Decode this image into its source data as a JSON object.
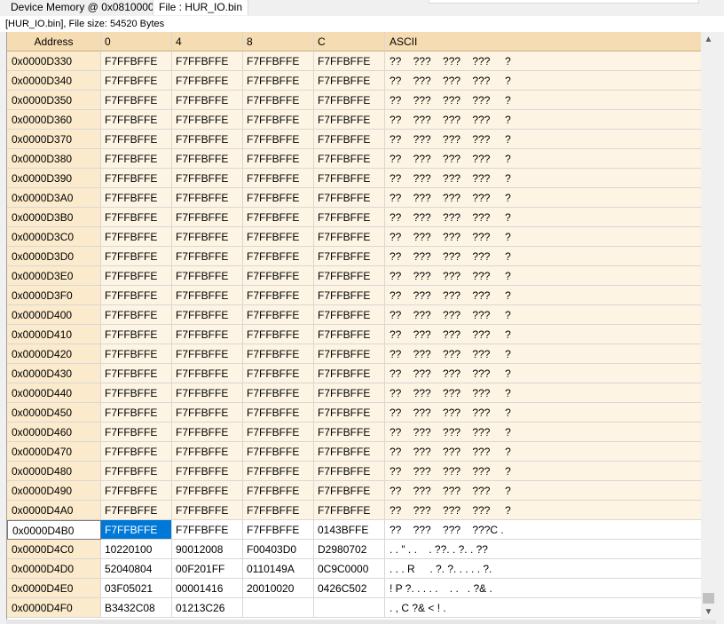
{
  "tabs": {
    "device_memory": "Device Memory @ 0x08100000 :",
    "file": "File : HUR_IO.bin"
  },
  "info": "[HUR_IO.bin], File size: 54520 Bytes",
  "columns": {
    "address": "Address",
    "c0": "0",
    "c4": "4",
    "c8": "8",
    "cc": "C",
    "ascii": "ASCII"
  },
  "rows": [
    {
      "addr": "0x0000D330",
      "c0": "F7FFBFFE",
      "c4": "F7FFBFFE",
      "c8": "F7FFBFFE",
      "cc": "F7FFBFFE",
      "ascii": "??    ???    ???    ???     ?"
    },
    {
      "addr": "0x0000D340",
      "c0": "F7FFBFFE",
      "c4": "F7FFBFFE",
      "c8": "F7FFBFFE",
      "cc": "F7FFBFFE",
      "ascii": "??    ???    ???    ???     ?"
    },
    {
      "addr": "0x0000D350",
      "c0": "F7FFBFFE",
      "c4": "F7FFBFFE",
      "c8": "F7FFBFFE",
      "cc": "F7FFBFFE",
      "ascii": "??    ???    ???    ???     ?"
    },
    {
      "addr": "0x0000D360",
      "c0": "F7FFBFFE",
      "c4": "F7FFBFFE",
      "c8": "F7FFBFFE",
      "cc": "F7FFBFFE",
      "ascii": "??    ???    ???    ???     ?"
    },
    {
      "addr": "0x0000D370",
      "c0": "F7FFBFFE",
      "c4": "F7FFBFFE",
      "c8": "F7FFBFFE",
      "cc": "F7FFBFFE",
      "ascii": "??    ???    ???    ???     ?"
    },
    {
      "addr": "0x0000D380",
      "c0": "F7FFBFFE",
      "c4": "F7FFBFFE",
      "c8": "F7FFBFFE",
      "cc": "F7FFBFFE",
      "ascii": "??    ???    ???    ???     ?"
    },
    {
      "addr": "0x0000D390",
      "c0": "F7FFBFFE",
      "c4": "F7FFBFFE",
      "c8": "F7FFBFFE",
      "cc": "F7FFBFFE",
      "ascii": "??    ???    ???    ???     ?"
    },
    {
      "addr": "0x0000D3A0",
      "c0": "F7FFBFFE",
      "c4": "F7FFBFFE",
      "c8": "F7FFBFFE",
      "cc": "F7FFBFFE",
      "ascii": "??    ???    ???    ???     ?"
    },
    {
      "addr": "0x0000D3B0",
      "c0": "F7FFBFFE",
      "c4": "F7FFBFFE",
      "c8": "F7FFBFFE",
      "cc": "F7FFBFFE",
      "ascii": "??    ???    ???    ???     ?"
    },
    {
      "addr": "0x0000D3C0",
      "c0": "F7FFBFFE",
      "c4": "F7FFBFFE",
      "c8": "F7FFBFFE",
      "cc": "F7FFBFFE",
      "ascii": "??    ???    ???    ???     ?"
    },
    {
      "addr": "0x0000D3D0",
      "c0": "F7FFBFFE",
      "c4": "F7FFBFFE",
      "c8": "F7FFBFFE",
      "cc": "F7FFBFFE",
      "ascii": "??    ???    ???    ???     ?"
    },
    {
      "addr": "0x0000D3E0",
      "c0": "F7FFBFFE",
      "c4": "F7FFBFFE",
      "c8": "F7FFBFFE",
      "cc": "F7FFBFFE",
      "ascii": "??    ???    ???    ???     ?"
    },
    {
      "addr": "0x0000D3F0",
      "c0": "F7FFBFFE",
      "c4": "F7FFBFFE",
      "c8": "F7FFBFFE",
      "cc": "F7FFBFFE",
      "ascii": "??    ???    ???    ???     ?"
    },
    {
      "addr": "0x0000D400",
      "c0": "F7FFBFFE",
      "c4": "F7FFBFFE",
      "c8": "F7FFBFFE",
      "cc": "F7FFBFFE",
      "ascii": "??    ???    ???    ???     ?"
    },
    {
      "addr": "0x0000D410",
      "c0": "F7FFBFFE",
      "c4": "F7FFBFFE",
      "c8": "F7FFBFFE",
      "cc": "F7FFBFFE",
      "ascii": "??    ???    ???    ???     ?"
    },
    {
      "addr": "0x0000D420",
      "c0": "F7FFBFFE",
      "c4": "F7FFBFFE",
      "c8": "F7FFBFFE",
      "cc": "F7FFBFFE",
      "ascii": "??    ???    ???    ???     ?"
    },
    {
      "addr": "0x0000D430",
      "c0": "F7FFBFFE",
      "c4": "F7FFBFFE",
      "c8": "F7FFBFFE",
      "cc": "F7FFBFFE",
      "ascii": "??    ???    ???    ???     ?"
    },
    {
      "addr": "0x0000D440",
      "c0": "F7FFBFFE",
      "c4": "F7FFBFFE",
      "c8": "F7FFBFFE",
      "cc": "F7FFBFFE",
      "ascii": "??    ???    ???    ???     ?"
    },
    {
      "addr": "0x0000D450",
      "c0": "F7FFBFFE",
      "c4": "F7FFBFFE",
      "c8": "F7FFBFFE",
      "cc": "F7FFBFFE",
      "ascii": "??    ???    ???    ???     ?"
    },
    {
      "addr": "0x0000D460",
      "c0": "F7FFBFFE",
      "c4": "F7FFBFFE",
      "c8": "F7FFBFFE",
      "cc": "F7FFBFFE",
      "ascii": "??    ???    ???    ???     ?"
    },
    {
      "addr": "0x0000D470",
      "c0": "F7FFBFFE",
      "c4": "F7FFBFFE",
      "c8": "F7FFBFFE",
      "cc": "F7FFBFFE",
      "ascii": "??    ???    ???    ???     ?"
    },
    {
      "addr": "0x0000D480",
      "c0": "F7FFBFFE",
      "c4": "F7FFBFFE",
      "c8": "F7FFBFFE",
      "cc": "F7FFBFFE",
      "ascii": "??    ???    ???    ???     ?"
    },
    {
      "addr": "0x0000D490",
      "c0": "F7FFBFFE",
      "c4": "F7FFBFFE",
      "c8": "F7FFBFFE",
      "cc": "F7FFBFFE",
      "ascii": "??    ???    ???    ???     ?"
    },
    {
      "addr": "0x0000D4A0",
      "c0": "F7FFBFFE",
      "c4": "F7FFBFFE",
      "c8": "F7FFBFFE",
      "cc": "F7FFBFFE",
      "ascii": "??    ???    ???    ???     ?"
    },
    {
      "addr": "0x0000D4B0",
      "c0": "F7FFBFFE",
      "c4": "F7FFBFFE",
      "c8": "F7FFBFFE",
      "cc": "0143BFFE",
      "ascii": "??    ???    ???    ???C ."
    },
    {
      "addr": "0x0000D4C0",
      "c0": "10220100",
      "c4": "90012008",
      "c8": "F00403D0",
      "cc": "D2980702",
      "ascii": ". . \" . .    . ??. . ?. . ??"
    },
    {
      "addr": "0x0000D4D0",
      "c0": "52040804",
      "c4": "00F201FF",
      "c8": "0110149A",
      "cc": "0C9C0000",
      "ascii": ". . . R     . ?. ?. . . . . ?."
    },
    {
      "addr": "0x0000D4E0",
      "c0": "03F05021",
      "c4": "00001416",
      "c8": "20010020",
      "cc": "0426C502",
      "ascii": "! P ?. . . . .    . .   . ?& ."
    },
    {
      "addr": "0x0000D4F0",
      "c0": "B3432C08",
      "c4": "01213C26",
      "c8": "",
      "cc": "",
      "ascii": ". , C ?& < ! ."
    }
  ],
  "colors": {
    "header_bg": "#f5dcb2",
    "address_bg": "#fbeacb",
    "filled_row_bg": "#fdf4e3",
    "selection": "#0078d7"
  }
}
